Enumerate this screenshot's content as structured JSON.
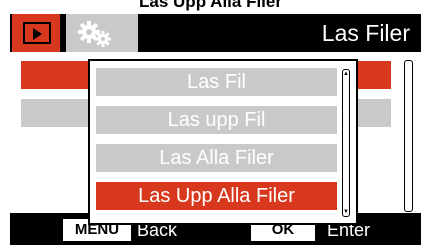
{
  "caption": "Las Upp Alla Filer",
  "header": {
    "title": "Las Filer",
    "tabs": [
      {
        "icon": "video-playback-icon",
        "active": true
      },
      {
        "icon": "settings-gears-icon",
        "active": false
      }
    ]
  },
  "popup": {
    "items": [
      {
        "label": "Las Fil",
        "selected": false
      },
      {
        "label": "Las upp Fil",
        "selected": false
      },
      {
        "label": "Las Alla Filer",
        "selected": false
      },
      {
        "label": "Las Upp Alla Filer",
        "selected": true
      }
    ]
  },
  "footer": {
    "menu_key": "MENU",
    "menu_label": "Back",
    "ok_key": "OK",
    "ok_label": "Enter"
  },
  "colors": {
    "accent": "#d8381e",
    "inactive": "#c9c9c9",
    "bar": "#000000"
  }
}
